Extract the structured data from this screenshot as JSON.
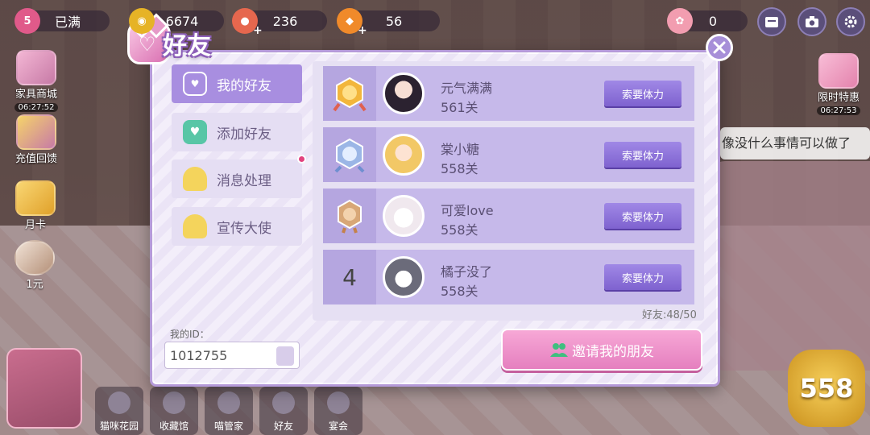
{
  "topbar": {
    "hearts": {
      "level": "5",
      "label": "已满"
    },
    "coins": {
      "value": "6674"
    },
    "cat_food": {
      "value": "236"
    },
    "gems": {
      "value": "56"
    },
    "paws": {
      "value": "0"
    }
  },
  "side_left": {
    "furniture_shop": {
      "label": "家具商城",
      "time": "06:27:52"
    },
    "recharge": {
      "label": "充值回馈"
    },
    "monthly_card": {
      "label": "月卡"
    },
    "one_yuan": {
      "label": "1元"
    }
  },
  "side_right": {
    "limited_offer": {
      "label": "限时特惠",
      "time": "06:27:53"
    },
    "bubble_text": "像没什么事情可以做了"
  },
  "bottom_nav": [
    "猫咪花园",
    "收藏馆",
    "喵管家",
    "好友",
    "宴会"
  ],
  "level_badge": "558",
  "dialog": {
    "title": "好友",
    "tabs": [
      {
        "label": "我的好友",
        "active": true,
        "icon": "friends-card-icon"
      },
      {
        "label": "添加好友",
        "active": false,
        "icon": "add-friend-icon"
      },
      {
        "label": "消息处理",
        "active": false,
        "icon": "bell-icon"
      },
      {
        "label": "宣传大使",
        "active": false,
        "icon": "bell-icon"
      }
    ],
    "my_id_label": "我的ID：",
    "my_id_value": "1012755",
    "friends": [
      {
        "rank": "1",
        "rank_icon": "gold-medal-icon",
        "name": "元气满满",
        "score": "561关",
        "action": "索要体力"
      },
      {
        "rank": "2",
        "rank_icon": "silver-medal-icon",
        "name": "棠小糖",
        "score": "558关",
        "action": "索要体力"
      },
      {
        "rank": "3",
        "rank_icon": "bronze-medal-icon",
        "name": "可爱love",
        "score": "558关",
        "action": "索要体力"
      },
      {
        "rank": "4",
        "rank_icon": "",
        "name": "橘子没了",
        "score": "558关",
        "action": "索要体力"
      }
    ],
    "friend_count": "好友:48/50",
    "invite_button": "邀请我的朋友"
  },
  "colors": {
    "accent": "#a88ee0",
    "row_bg": "#c6b9ea",
    "invite_pink": "#e57fbf",
    "notif": "#e2427e"
  }
}
